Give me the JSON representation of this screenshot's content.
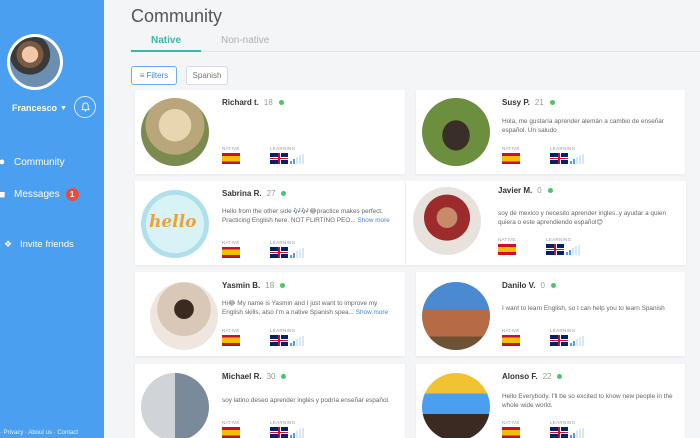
{
  "sidebar": {
    "user_name": "Francesco",
    "nav": {
      "community": "Community",
      "messages": "Messages",
      "messages_badge": "1",
      "invite": "Invite friends"
    },
    "footer": "· Privacy · About us · Contact"
  },
  "main": {
    "title": "Community",
    "tabs": {
      "native": "Native",
      "non_native": "Non-native"
    },
    "filters_label": "Filters",
    "language_chip": "Spanish"
  },
  "labels": {
    "native": "NATIVE",
    "learning": "LEARNING",
    "show_more": "Show more"
  },
  "cards": [
    {
      "name": "Richard t.",
      "age": "18",
      "message": "",
      "native_flag": "spain-flag",
      "learning_flag": "uk-flag",
      "level": 2
    },
    {
      "name": "Susy P.",
      "age": "21",
      "message": "Hola, me gustaría aprender alemán a cambio de enseñar español. Un saludo",
      "native_flag": "spain-flag",
      "learning_flag": "uk-flag",
      "level": 2
    },
    {
      "name": "Sabrina R.",
      "age": "27",
      "message": "Hello from the other side 🎶🎶😂practice makes perfect. Practicing English here. NOT FLIRTING PEO...",
      "native_flag": "spain-flag",
      "learning_flag": "uk-flag",
      "level": 2,
      "hello_text": "hello"
    },
    {
      "name": "Javier M.",
      "age": "0",
      "message": "soy de mexico y necesito aprender ingles..y ayudar a quien quiera o este aprendiendo español😊",
      "native_flag": "spain-flag",
      "learning_flag": "uk-flag",
      "level": 2
    },
    {
      "name": "Yasmin B.",
      "age": "18",
      "message": "Hi😂 My name is Yasmin and I just want to improve my English skills, also I'm a native Spanish spea...",
      "native_flag": "spain-flag",
      "learning_flag": "uk-flag",
      "level": 2
    },
    {
      "name": "Danilo V.",
      "age": "0",
      "message": "I want to learn English, so I can help you to learn Spanish",
      "native_flag": "spain-flag",
      "learning_flag": "uk-flag",
      "level": 2
    },
    {
      "name": "Michael R.",
      "age": "30",
      "message": "soy latino deseo aprender inglés y podría enseñar español.",
      "native_flag": "spain-flag",
      "learning_flag": "uk-flag",
      "level": 2
    },
    {
      "name": "Alonso F.",
      "age": "22",
      "message": "Hello Everybody. I'll be so excited to know new people in the whole wide world.",
      "native_flag": "spain-flag",
      "learning_flag": "uk-flag",
      "level": 2
    }
  ]
}
